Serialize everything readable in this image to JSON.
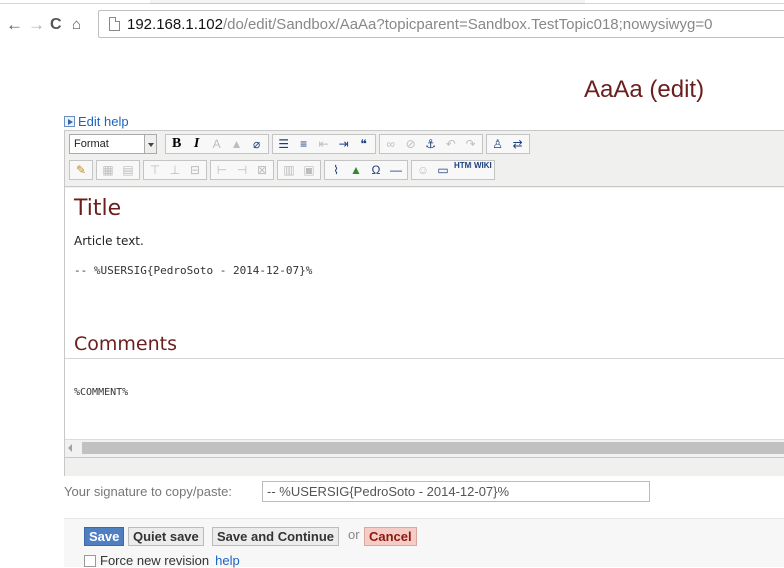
{
  "browser": {
    "url_host": "192.168.1.102",
    "url_path": "/do/edit/Sandbox/AaAa?topicparent=Sandbox.TestTopic018;nowysiwyg=0",
    "back_glyph": "←",
    "forward_glyph": "→",
    "reload_glyph": "C",
    "home_glyph": "⌂"
  },
  "page": {
    "title": "AaAa (edit)",
    "edit_help_label": "Edit help"
  },
  "toolbar": {
    "format_label": "Format",
    "row1_groups": [
      [
        {
          "icon": "bold-icon",
          "glyph": "B",
          "cls": "b"
        },
        {
          "icon": "italic-icon",
          "glyph": "I",
          "cls": "i"
        },
        {
          "icon": "text-color-icon",
          "glyph": "A",
          "cls": "dis"
        },
        {
          "icon": "highlight-icon",
          "glyph": "▲",
          "cls": "dis"
        },
        {
          "icon": "eraser-icon",
          "glyph": "⌀",
          "cls": ""
        }
      ],
      [
        {
          "icon": "bullet-list-icon",
          "glyph": "☰",
          "cls": ""
        },
        {
          "icon": "numbered-list-icon",
          "glyph": "≡",
          "cls": ""
        },
        {
          "icon": "outdent-icon",
          "glyph": "⇤",
          "cls": "dis"
        },
        {
          "icon": "indent-icon",
          "glyph": "⇥",
          "cls": ""
        },
        {
          "icon": "blockquote-icon",
          "glyph": "❝",
          "cls": ""
        }
      ],
      [
        {
          "icon": "link-icon",
          "glyph": "∞",
          "cls": "dis"
        },
        {
          "icon": "unlink-icon",
          "glyph": "⊘",
          "cls": "dis"
        },
        {
          "icon": "anchor-icon",
          "glyph": "⚓",
          "cls": ""
        },
        {
          "icon": "undo-icon",
          "glyph": "↶",
          "cls": "dis"
        },
        {
          "icon": "redo-icon",
          "glyph": "↷",
          "cls": "dis"
        }
      ],
      [
        {
          "icon": "find-icon",
          "glyph": "♙",
          "cls": ""
        },
        {
          "icon": "replace-icon",
          "glyph": "⇄",
          "cls": ""
        }
      ]
    ],
    "row2_groups": [
      [
        {
          "icon": "edit-source-icon",
          "glyph": "✎",
          "cls": "gold"
        }
      ],
      [
        {
          "icon": "table-icon",
          "glyph": "▦",
          "cls": "dis"
        },
        {
          "icon": "table-props-icon",
          "glyph": "▤",
          "cls": "dis"
        }
      ],
      [
        {
          "icon": "row-before-icon",
          "glyph": "⊤",
          "cls": "dis"
        },
        {
          "icon": "row-after-icon",
          "glyph": "⊥",
          "cls": "dis"
        },
        {
          "icon": "delete-row-icon",
          "glyph": "⊟",
          "cls": "dis"
        }
      ],
      [
        {
          "icon": "col-before-icon",
          "glyph": "⊢",
          "cls": "dis"
        },
        {
          "icon": "col-after-icon",
          "glyph": "⊣",
          "cls": "dis"
        },
        {
          "icon": "delete-col-icon",
          "glyph": "⊠",
          "cls": "dis"
        }
      ],
      [
        {
          "icon": "split-cell-icon",
          "glyph": "▥",
          "cls": "dis"
        },
        {
          "icon": "merge-cells-icon",
          "glyph": "▣",
          "cls": "dis"
        }
      ],
      [
        {
          "icon": "attach-icon",
          "glyph": "⌇",
          "cls": ""
        },
        {
          "icon": "insert-image-icon",
          "glyph": "▲",
          "cls": "green"
        },
        {
          "icon": "special-char-icon",
          "glyph": "Ω",
          "cls": ""
        },
        {
          "icon": "horizontal-rule-icon",
          "glyph": "—",
          "cls": ""
        }
      ],
      [
        {
          "icon": "smiley-icon",
          "glyph": "☺",
          "cls": "dis"
        },
        {
          "icon": "fullscreen-icon",
          "glyph": "▭",
          "cls": ""
        },
        {
          "icon": "html-icon",
          "glyph": "HTML",
          "cls": "sm"
        },
        {
          "icon": "wiki-text-icon",
          "glyph": "WIKI TEXT",
          "cls": "sm"
        }
      ]
    ]
  },
  "content": {
    "heading_title": "Title",
    "article_text": "Article text.",
    "signature_line": "-- %USERSIG{PedroSoto - 2014-12-07}%",
    "heading_comments": "Comments",
    "comment_macro": "%COMMENT%"
  },
  "signature": {
    "label": "Your signature to copy/paste:",
    "value": "-- %USERSIG{PedroSoto - 2014-12-07}%"
  },
  "actions": {
    "save_label": "Save",
    "quiet_save_label": "Quiet save",
    "save_continue_label": "Save and Continue",
    "or_text": "or",
    "cancel_label": "Cancel",
    "force_revision_label": "Force new revision",
    "help_label": "help"
  },
  "colors": {
    "title_color": "#6b1e1e",
    "link_color": "#1a65c0",
    "save_button": "#4f7ec1",
    "cancel_button": "#f5cdc6"
  }
}
